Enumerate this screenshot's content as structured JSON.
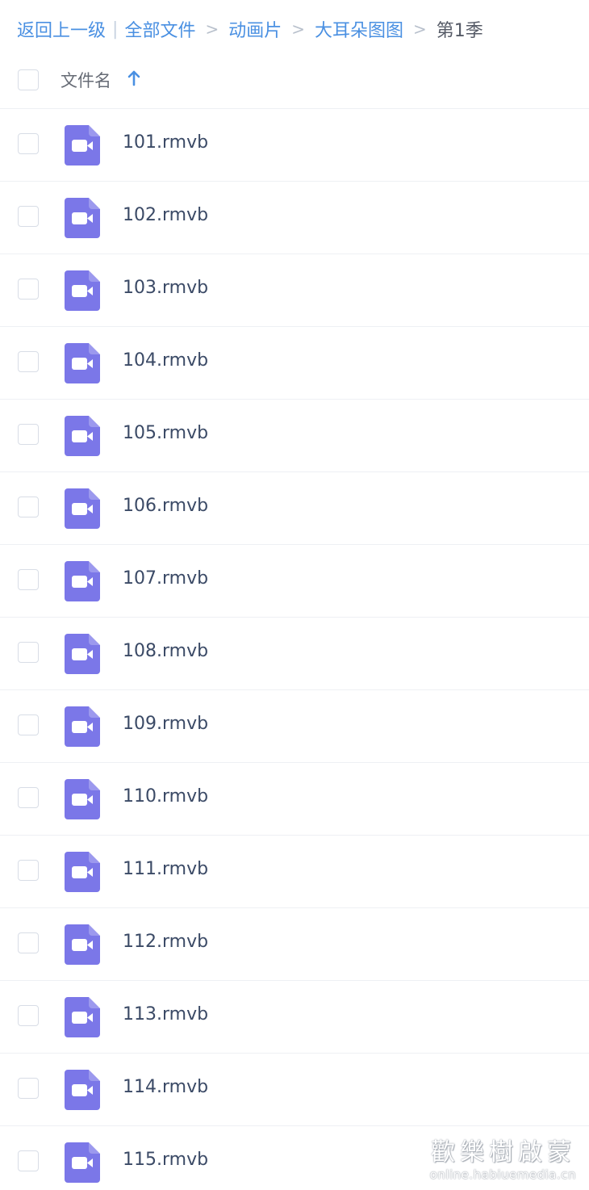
{
  "breadcrumb": {
    "back": "返回上一级",
    "root": "全部文件",
    "path": [
      "动画片",
      "大耳朵图图"
    ],
    "current": "第1季"
  },
  "header": {
    "column_label": "文件名",
    "sort": "ascending"
  },
  "files": [
    {
      "name": "101.rmvb"
    },
    {
      "name": "102.rmvb"
    },
    {
      "name": "103.rmvb"
    },
    {
      "name": "104.rmvb"
    },
    {
      "name": "105.rmvb"
    },
    {
      "name": "106.rmvb"
    },
    {
      "name": "107.rmvb"
    },
    {
      "name": "108.rmvb"
    },
    {
      "name": "109.rmvb"
    },
    {
      "name": "110.rmvb"
    },
    {
      "name": "111.rmvb"
    },
    {
      "name": "112.rmvb"
    },
    {
      "name": "113.rmvb"
    },
    {
      "name": "114.rmvb"
    },
    {
      "name": "115.rmvb"
    }
  ],
  "watermark": {
    "title": "歡樂樹啟蒙",
    "url": "online.habiuemedia.cn"
  },
  "colors": {
    "link": "#4a90e2",
    "video_icon": "#7b77e8",
    "file_name": "#3b4a66"
  },
  "icons": {
    "sort": "arrow-up-icon",
    "file": "video-file-icon"
  }
}
